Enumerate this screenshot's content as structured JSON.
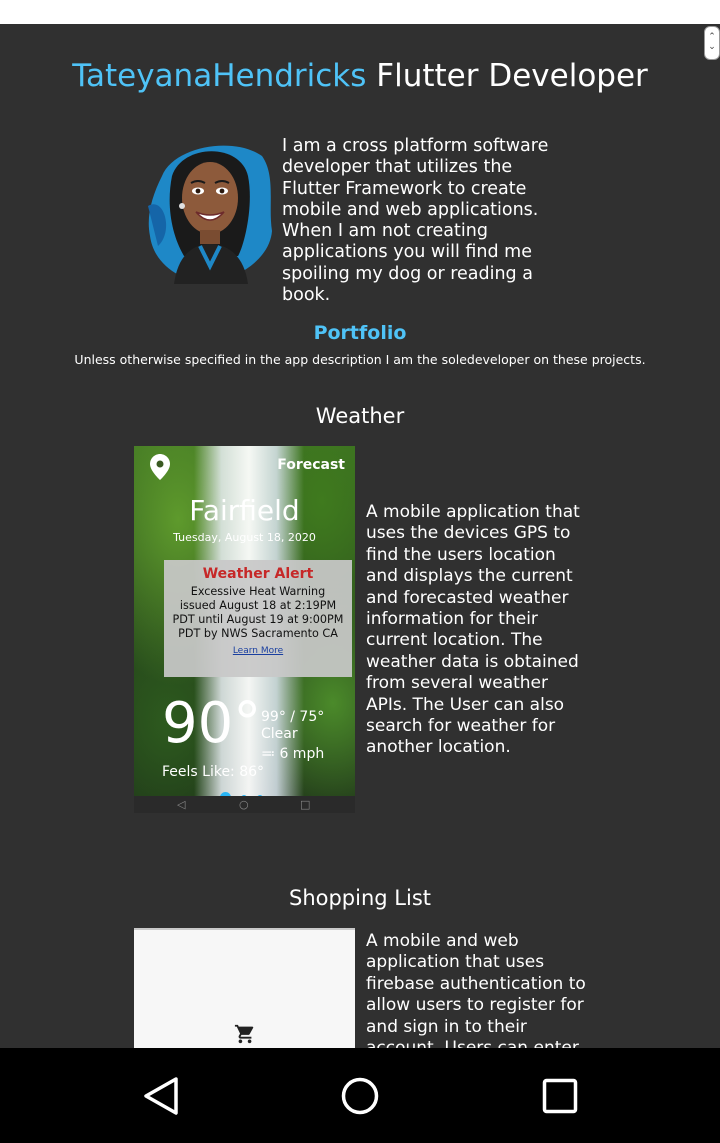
{
  "header": {
    "name": "TateyanaHendricks",
    "role": "Flutter Developer"
  },
  "bio": "I am a cross platform software developer that utilizes the Flutter Framework to create mobile and web applications. When I am not creating applications you will find me spoiling my dog or reading a book.",
  "portfolio": {
    "heading": "Portfolio",
    "note": "Unless otherwise specified in the app description I am the soledeveloper on these projects."
  },
  "projects": [
    {
      "title": "Weather",
      "description": "A mobile application that uses the devices GPS to find the users location and displays the current and forecasted weather information for their current location. The weather data is obtained from several weather APIs. The User can also search for weather for another location.",
      "screenshot": {
        "forecast_label": "Forecast",
        "city": "Fairfield",
        "date": "Tuesday, August 18, 2020",
        "alert_title": "Weather Alert",
        "alert_body": "Excessive Heat Warning issued August 18 at 2:19PM PDT until August 19 at 9:00PM PDT by NWS Sacramento CA",
        "alert_link": "Learn More",
        "temperature": "90°",
        "hi_lo": "99° / 75°",
        "condition": "Clear",
        "wind": "6 mph",
        "feels_like": "Feels Like: 86°"
      }
    },
    {
      "title": "Shopping List",
      "description": "A mobile and web application that uses firebase authentication to allow users to register for and sign in to their account. Users can enter"
    }
  ],
  "icons": {
    "location": "location-pin-icon",
    "cart": "shopping-cart-icon",
    "back": "back-icon",
    "home": "home-icon",
    "recents": "recents-icon",
    "wind": "wind-icon"
  },
  "colors": {
    "background": "#303030",
    "accent": "#4fc3f7",
    "alert_title": "#c62828",
    "nav_bar": "#000000"
  }
}
